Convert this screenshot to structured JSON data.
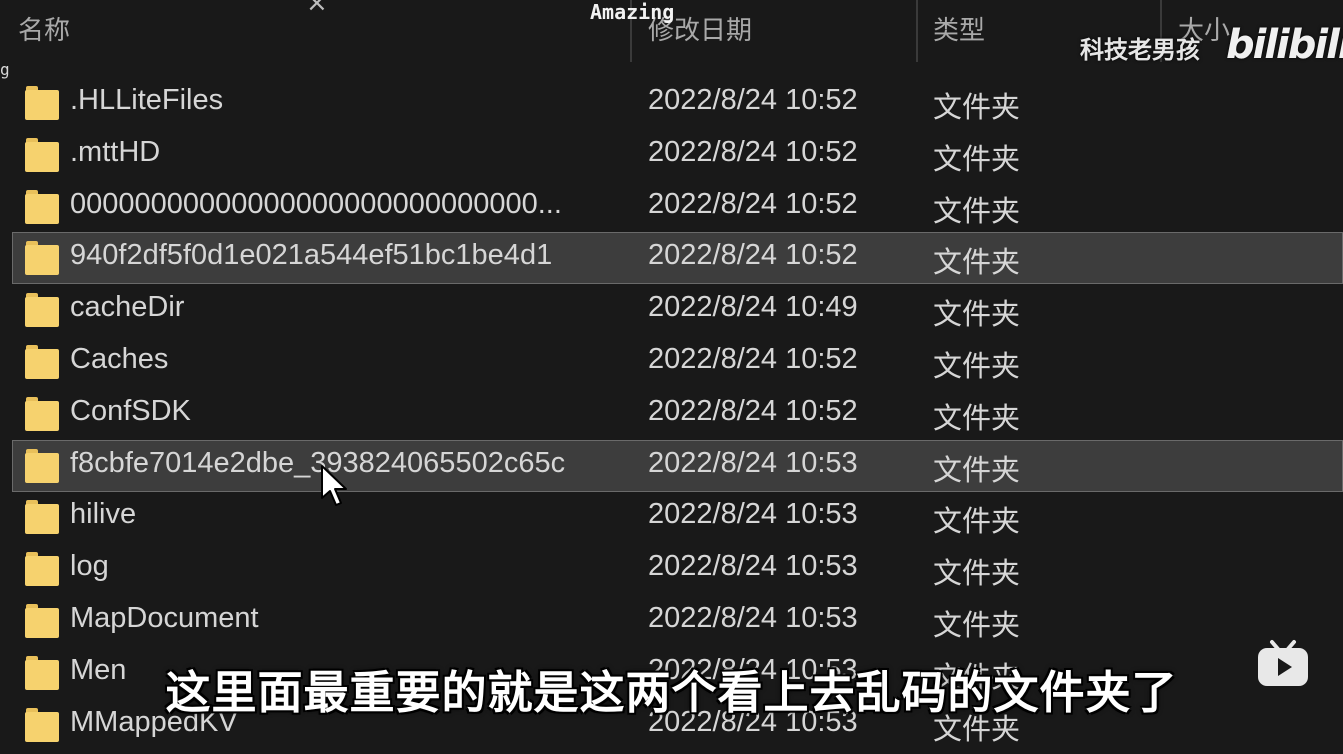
{
  "header": {
    "columns": {
      "name": "名称",
      "date": "修改日期",
      "type": "类型",
      "size": "大小"
    },
    "close_glyph": "×"
  },
  "left_edge_text": "g",
  "files": [
    {
      "name": ".HLLiteFiles",
      "date": "2022/8/24 10:52",
      "type": "文件夹",
      "selected": false
    },
    {
      "name": ".mttHD",
      "date": "2022/8/24 10:52",
      "type": "文件夹",
      "selected": false
    },
    {
      "name": "00000000000000000000000000000...",
      "date": "2022/8/24 10:52",
      "type": "文件夹",
      "selected": false
    },
    {
      "name": "940f2df5f0d1e021a544ef51bc1be4d1",
      "date": "2022/8/24 10:52",
      "type": "文件夹",
      "selected": true
    },
    {
      "name": "cacheDir",
      "date": "2022/8/24 10:49",
      "type": "文件夹",
      "selected": false
    },
    {
      "name": "Caches",
      "date": "2022/8/24 10:52",
      "type": "文件夹",
      "selected": false
    },
    {
      "name": "ConfSDK",
      "date": "2022/8/24 10:52",
      "type": "文件夹",
      "selected": false
    },
    {
      "name": "f8cbfe7014e2dbe_393824065502c65c",
      "date": "2022/8/24 10:53",
      "type": "文件夹",
      "selected": true
    },
    {
      "name": "hilive",
      "date": "2022/8/24 10:53",
      "type": "文件夹",
      "selected": false
    },
    {
      "name": "log",
      "date": "2022/8/24 10:53",
      "type": "文件夹",
      "selected": false
    },
    {
      "name": "MapDocument",
      "date": "2022/8/24 10:53",
      "type": "文件夹",
      "selected": false
    },
    {
      "name": "Men",
      "date": "2022/8/24 10:53",
      "type": "文件夹",
      "selected": false
    },
    {
      "name": "MMappedKV",
      "date": "2022/8/24 10:53",
      "type": "文件夹",
      "selected": false
    }
  ],
  "overlay": {
    "top_watermark": "Amazing",
    "author": "科技老男孩",
    "logo": "bilibili",
    "subtitle": "这里面最重要的就是这两个看上去乱码的文件夹了",
    "tv_icon": "bilibili-tv-icon"
  },
  "colors": {
    "background": "#191919",
    "selected_row": "#3d3d3d",
    "folder": "#f6d26e",
    "text": "#d6d6d6"
  }
}
